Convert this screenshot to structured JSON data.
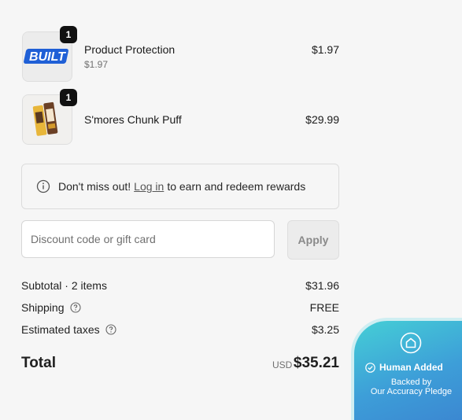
{
  "cart": {
    "items": [
      {
        "name": "Product Protection",
        "sub_price": "$1.97",
        "price": "$1.97",
        "quantity": "1",
        "thumbnail_text": "BUILT",
        "thumbnail": "built-logo"
      },
      {
        "name": "S'mores Chunk Puff",
        "price": "$29.99",
        "quantity": "1",
        "thumbnail": "smores-bars-image"
      }
    ]
  },
  "rewards": {
    "icon": "info-icon",
    "prefix": "Don't miss out!",
    "link_label": "Log in",
    "suffix": "to earn and redeem rewards"
  },
  "discount": {
    "placeholder": "Discount code or gift card",
    "value": "",
    "apply_label": "Apply"
  },
  "summary": {
    "subtotal_label": "Subtotal · 2 items",
    "subtotal_value": "$31.96",
    "shipping_label": "Shipping",
    "shipping_value": "FREE",
    "taxes_label": "Estimated taxes",
    "taxes_value": "$3.25",
    "help_icon": "question-circle-icon",
    "total_label": "Total",
    "currency": "USD",
    "total_value": "$35.21"
  },
  "pledge_badge": {
    "icon": "house-icon",
    "check_icon": "check-circle-icon",
    "title": "Human Added",
    "line1": "Backed by",
    "line2": "Our Accuracy Pledge",
    "colors": {
      "start": "#45cfd6",
      "end": "#3b86d1"
    }
  }
}
